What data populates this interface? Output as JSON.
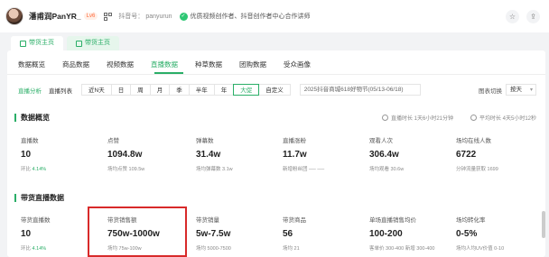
{
  "header": {
    "username": "潘甫润PanYR_",
    "level_badge": "Lv6",
    "douyin_id_label": "抖音号：",
    "douyin_id": "panyurun",
    "certification": "优质视频创作者、抖音创作者中心合作讲师"
  },
  "top_tabs": [
    {
      "label": "带货主页",
      "active": true
    },
    {
      "label": "带货主页",
      "active": false
    }
  ],
  "nav_tabs": [
    "数据概览",
    "商品数据",
    "视频数据",
    "直播数据",
    "种草数据",
    "团购数据",
    "受众画像"
  ],
  "nav_active_index": 3,
  "filter": {
    "tabs": [
      "直播分析",
      "直播列表"
    ],
    "ranges": [
      "近N天",
      "日",
      "周",
      "月",
      "季",
      "半年",
      "年",
      "大促",
      "自定义"
    ],
    "active_range": "大促",
    "date_range": "2025抖音商城618好物节(05/13-06/18)",
    "chart_mode_label": "图表切换",
    "chart_mode_value": "按天"
  },
  "overview": {
    "title": "数据概览",
    "update_note": "直播时长 1天6小时21分钟",
    "average_note": "平均时长 4天5小时12秒",
    "cards": [
      {
        "label": "直播数",
        "value": "10",
        "sub": "环比",
        "sub_value": "4.14%"
      },
      {
        "label": "点赞",
        "value": "1094.8w",
        "sub": "场均点赞 109.5w"
      },
      {
        "label": "弹幕数",
        "value": "31.4w",
        "sub": "场均弹幕数 3.1w"
      },
      {
        "label": "直播涨粉",
        "value": "11.7w",
        "sub": "新增粉丝团 ── ──"
      },
      {
        "label": "观看人次",
        "value": "306.4w",
        "sub": "场均观看 30.6w"
      },
      {
        "label": "场均在线人数",
        "value": "6722",
        "sub": "分钟流量获取 1699"
      }
    ]
  },
  "sales": {
    "title": "带货直播数据",
    "cards": [
      {
        "label": "带货直播数",
        "value": "10",
        "sub": "环比",
        "sub_value": "4.14%"
      },
      {
        "label": "带货销售额",
        "value": "750w-1000w",
        "sub": "场均 75w-100w"
      },
      {
        "label": "带货销量",
        "value": "5w-7.5w",
        "sub": "场均 5000-7500"
      },
      {
        "label": "带货商品",
        "value": "56",
        "sub": "场均 21"
      },
      {
        "label": "单场直播销售均价",
        "value": "100-200",
        "sub": "客单价 300-400 新增 300-400"
      },
      {
        "label": "场均转化率",
        "value": "0-5%",
        "sub": "场均人均UV价值 0-10"
      }
    ]
  }
}
